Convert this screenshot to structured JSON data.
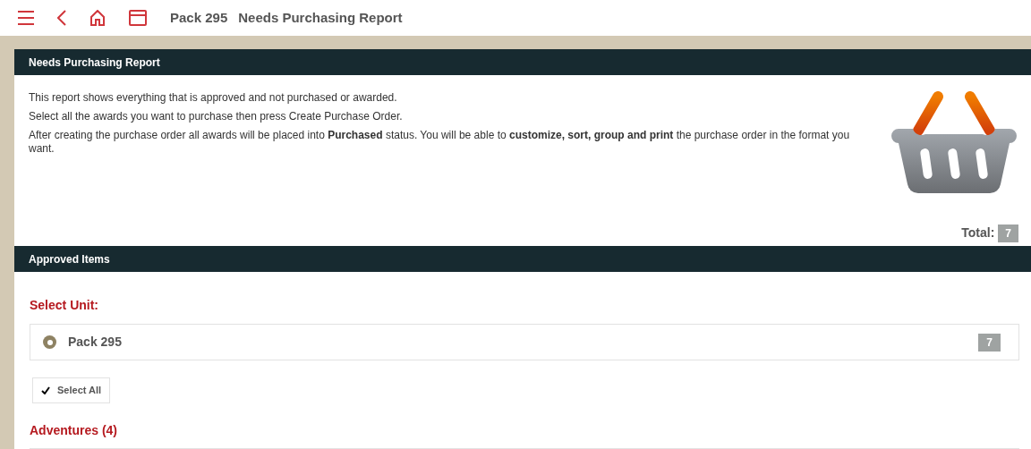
{
  "topbar": {
    "unit": "Pack 295",
    "title": "Needs Purchasing Report"
  },
  "report_panel": {
    "heading": "Needs Purchasing Report",
    "paragraphs": [
      "This report shows everything that is approved and not purchased or awarded.",
      "Select all the awards you want to purchase then press Create Purchase Order.",
      "After creating the purchase order all awards will be placed into **Purchased** status. You will be able to **customize, sort, group and print** the purchase order in the format you want."
    ],
    "total_label": "Total:",
    "total": "7"
  },
  "approved_panel": {
    "heading": "Approved Items",
    "select_unit_label": "Select Unit:",
    "units": [
      {
        "name": "Pack 295",
        "count": "7",
        "selected": true
      }
    ],
    "select_all": "Select All",
    "groups": [
      {
        "title": "Adventures (4)"
      }
    ]
  }
}
